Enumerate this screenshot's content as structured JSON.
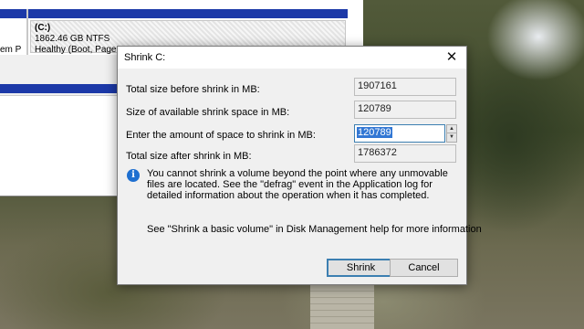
{
  "disk_management": {
    "partition_name": "(C:)",
    "partition_size": "1862.46 GB NTFS",
    "partition_status": "Healthy (Boot, Page",
    "left_partition_text": "em P"
  },
  "dialog": {
    "title": "Shrink C:",
    "close_glyph": "✕",
    "fields": {
      "total_before_label": "Total size before shrink in MB:",
      "total_before_value": "1907161",
      "available_label": "Size of available shrink space in MB:",
      "available_value": "120789",
      "amount_label": "Enter the amount of space to shrink in MB:",
      "amount_value": "120789",
      "total_after_label": "Total size after shrink in MB:",
      "total_after_value": "1786372"
    },
    "info_icon_glyph": "i",
    "info_text": "You cannot shrink a volume beyond the point where any unmovable files are located. See the \"defrag\" event in the Application log for detailed information about the operation when it has completed.",
    "help_text": "See \"Shrink a basic volume\" in Disk Management help for more information",
    "buttons": {
      "shrink": "Shrink",
      "cancel": "Cancel"
    },
    "spinner": {
      "up": "▲",
      "down": "▼"
    }
  },
  "colors": {
    "accent": "#3277d4",
    "disk_bar": "#1c39a8",
    "info_icon": "#1e6fd0"
  }
}
